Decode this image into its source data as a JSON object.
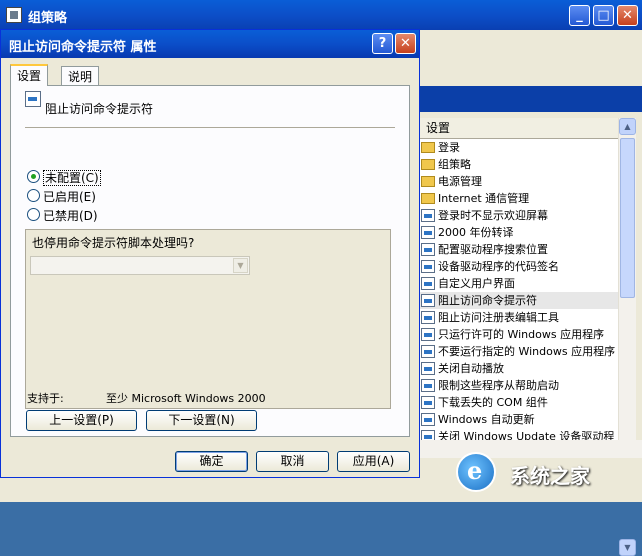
{
  "background_window": {
    "title": "组策略",
    "controls": {
      "minimize": "_",
      "maximize": "□",
      "close": "✕"
    },
    "list": {
      "header": "设置",
      "items": [
        {
          "label": "登录",
          "icon": "folder-icon"
        },
        {
          "label": "组策略",
          "icon": "folder-icon"
        },
        {
          "label": "电源管理",
          "icon": "folder-icon"
        },
        {
          "label": "Internet 通信管理",
          "icon": "folder-icon"
        },
        {
          "label": "登录时不显示欢迎屏幕",
          "icon": "policy-setting-icon"
        },
        {
          "label": "2000 年份转译",
          "icon": "policy-setting-icon"
        },
        {
          "label": "配置驱动程序搜索位置",
          "icon": "policy-setting-icon"
        },
        {
          "label": "设备驱动程序的代码签名",
          "icon": "policy-setting-icon"
        },
        {
          "label": "自定义用户界面",
          "icon": "policy-setting-icon"
        },
        {
          "label": "阻止访问命令提示符",
          "icon": "policy-setting-icon",
          "selected": true
        },
        {
          "label": "阻止访问注册表编辑工具",
          "icon": "policy-setting-icon"
        },
        {
          "label": "只运行许可的 Windows 应用程序",
          "icon": "policy-setting-icon"
        },
        {
          "label": "不要运行指定的 Windows 应用程序",
          "icon": "policy-setting-icon"
        },
        {
          "label": "关闭自动播放",
          "icon": "policy-setting-icon"
        },
        {
          "label": "限制这些程序从帮助启动",
          "icon": "policy-setting-icon"
        },
        {
          "label": "下载丢失的 COM 组件",
          "icon": "policy-setting-icon"
        },
        {
          "label": "Windows 自动更新",
          "icon": "policy-setting-icon"
        },
        {
          "label": "关闭 Windows Update 设备驱动程",
          "icon": "policy-setting-icon"
        }
      ]
    },
    "watermark": "系统之家"
  },
  "dialog": {
    "title": "阻止访问命令提示符 属性",
    "help": "?",
    "close": "✕",
    "tabs": [
      "设置",
      "说明"
    ],
    "setting_name": "阻止访问命令提示符",
    "radios": [
      {
        "label": "未配置(C)",
        "checked": true
      },
      {
        "label": "已启用(E)",
        "checked": false
      },
      {
        "label": "已禁用(D)",
        "checked": false
      }
    ],
    "option_question": "也停用命令提示符脚本处理吗?",
    "supported_label": "支持于:",
    "supported_value": "至少 Microsoft Windows 2000",
    "prev_button": "上一设置(P)",
    "next_button": "下一设置(N)",
    "ok_button": "确定",
    "cancel_button": "取消",
    "apply_button": "应用(A)"
  },
  "colors": {
    "titlebar": "#0b4ec9",
    "dialog_bg": "#ece9d8",
    "selected_row": "#e7e7e7",
    "radio_dot": "#21a121"
  }
}
